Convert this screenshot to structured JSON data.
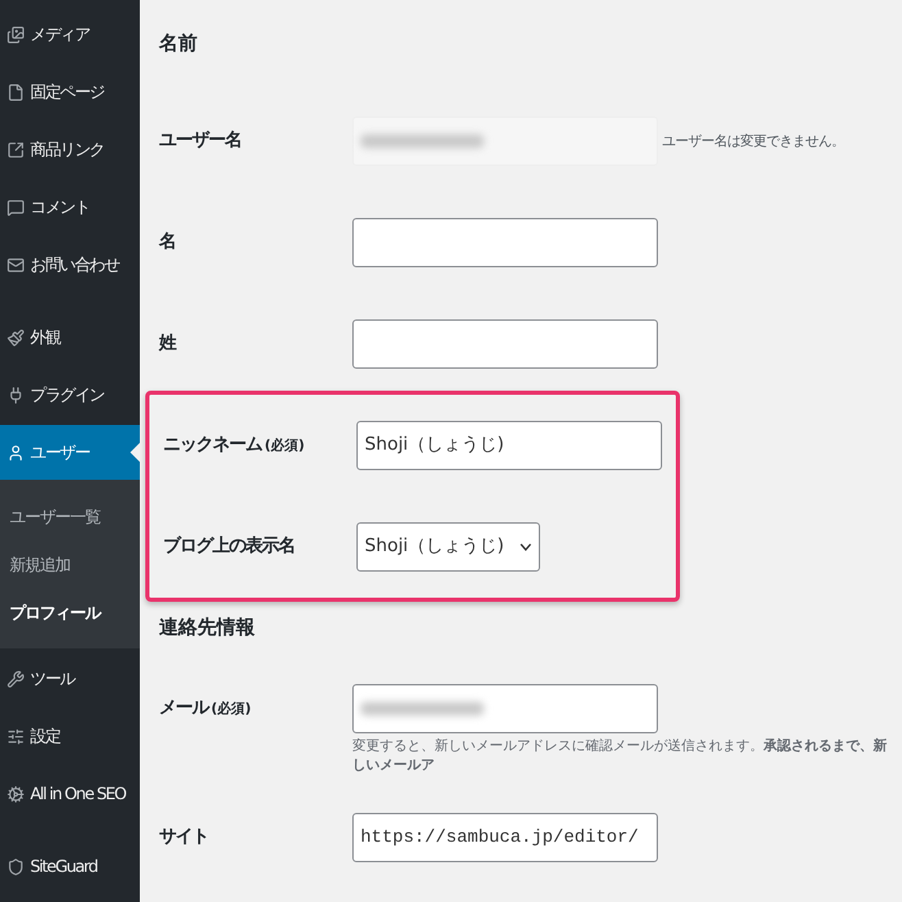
{
  "sidebar": {
    "items": [
      {
        "label": "メディア",
        "selected": false
      },
      {
        "label": "固定ページ",
        "selected": false
      },
      {
        "label": "商品リンク",
        "selected": false
      },
      {
        "label": "コメント",
        "selected": false
      },
      {
        "label": "お問い合わせ",
        "selected": false
      },
      {
        "label": "外観",
        "selected": false
      },
      {
        "label": "プラグイン",
        "selected": false
      },
      {
        "label": "ユーザー",
        "selected": true,
        "children": [
          {
            "label": "ユーザー一覧",
            "selected": false
          },
          {
            "label": "新規追加",
            "selected": false
          },
          {
            "label": "プロフィール",
            "selected": true
          }
        ]
      },
      {
        "label": "ツール",
        "selected": false
      },
      {
        "label": "設定",
        "selected": false
      },
      {
        "label": "All in One SEO",
        "selected": false
      },
      {
        "label": "SiteGuard",
        "selected": false
      }
    ]
  },
  "sections": [
    {
      "heading": "名前",
      "rows": [
        {
          "kind": "readonly",
          "label": "ユーザー名",
          "value_redacted": true,
          "note": "ユーザー名は変更できません。"
        },
        {
          "kind": "text",
          "label": "名"
        },
        {
          "kind": "text",
          "label": "姓"
        },
        {
          "kind": "text",
          "label": "ニックネーム",
          "required_note": "(必須)",
          "value": "Shoji（しょうじ)",
          "highlighted": true
        },
        {
          "kind": "select",
          "label": "ブログ上の表示名",
          "value": "Shoji（しょうじ)",
          "highlighted": true
        }
      ]
    },
    {
      "heading": "連絡先情報",
      "rows": [
        {
          "kind": "text",
          "label": "メール",
          "required_note": "(必須)",
          "value_redacted": true,
          "help": "変更すると、新しいメールアドレスに確認メールが送信されます。**承認されるまで、新しいメールア**"
        },
        {
          "kind": "text",
          "label": "サイト",
          "value": "https://sambuca.jp/editor/",
          "mono": true
        }
      ]
    }
  ]
}
